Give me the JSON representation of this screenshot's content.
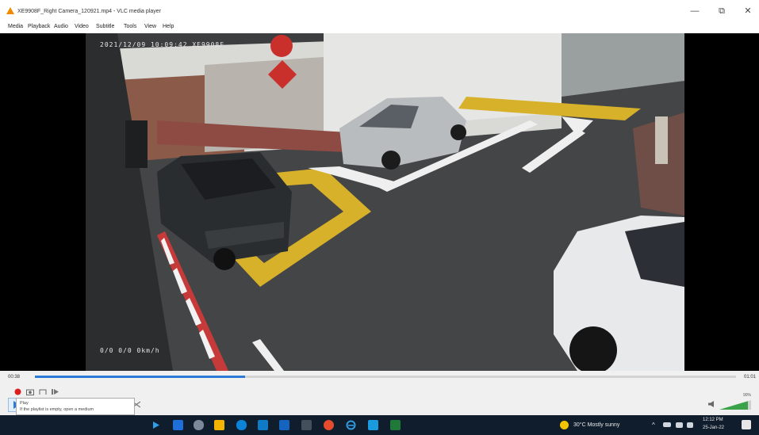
{
  "window": {
    "title": "XE9908F_Right Camera_120921.mp4 - VLC media player",
    "minimize_glyph": "—",
    "maximize_glyph": "⧉",
    "close_glyph": "✕"
  },
  "menu": [
    "Media",
    "Playback",
    "Audio",
    "Video",
    "Subtitle",
    "Tools",
    "View",
    "Help"
  ],
  "video": {
    "osd_top": "2021/12/09 10:09:42 XE9908F",
    "osd_bottom": "0/0 0/0  0km/h"
  },
  "player": {
    "time_elapsed": "00:38",
    "time_total": "01:01",
    "progress_fraction": 0.3,
    "volume_label": "90%",
    "volume_fraction": 0.9,
    "accent_color": "#2b7bd6",
    "record_color": "#d81e1e"
  },
  "tooltip": {
    "title": "Play",
    "text": "If the playlist is empty, open a medium"
  },
  "taskbar": {
    "weather": "30°C  Mostly sunny",
    "clock_time": "12:12 PM",
    "clock_date": "25-Jan-22"
  }
}
